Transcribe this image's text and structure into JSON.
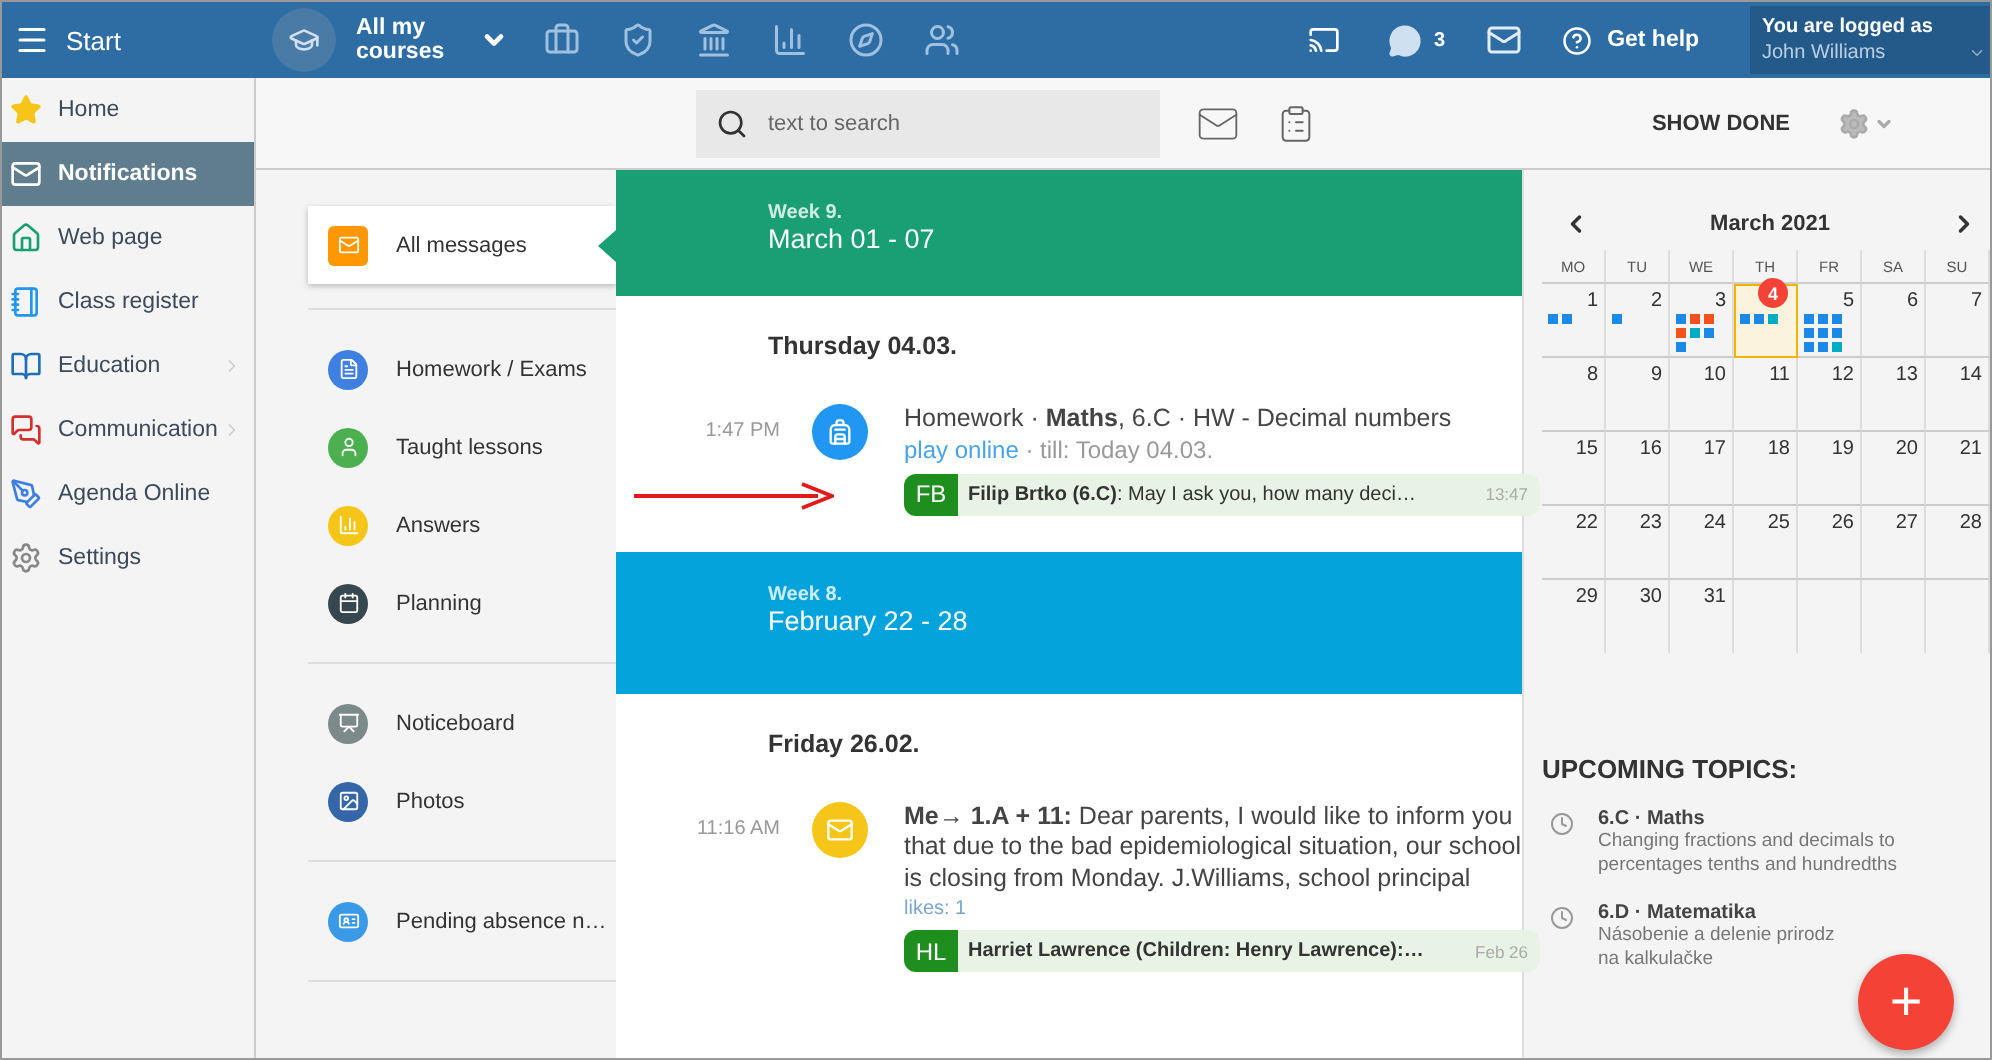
{
  "topbar": {
    "menu_label": "Start",
    "courses_label": "All my courses",
    "chat_count": "3",
    "help": "Get help",
    "user": {
      "caption": "You are logged as",
      "name": "John Williams"
    }
  },
  "sidebar": {
    "items": [
      {
        "label": "Home",
        "selected": false,
        "submenu": false
      },
      {
        "label": "Notifications",
        "selected": true,
        "submenu": false
      },
      {
        "label": "Web page",
        "selected": false,
        "submenu": false
      },
      {
        "label": "Class register",
        "selected": false,
        "submenu": false
      },
      {
        "label": "Education",
        "selected": false,
        "submenu": true
      },
      {
        "label": "Communication",
        "selected": false,
        "submenu": true
      },
      {
        "label": "Agenda Online",
        "selected": false,
        "submenu": false
      },
      {
        "label": "Settings",
        "selected": false,
        "submenu": false
      }
    ]
  },
  "toolbar": {
    "search": {
      "placeholder": "text to search"
    },
    "show_done": "SHOW DONE"
  },
  "filters": [
    [
      {
        "label": "All messages",
        "color": "#ff9800",
        "selected": true
      }
    ],
    [
      {
        "label": "Homework / Exams",
        "color": "#3f7fe0",
        "selected": false
      },
      {
        "label": "Taught lessons",
        "color": "#4caf50",
        "selected": false
      },
      {
        "label": "Answers",
        "color": "#f5c518",
        "selected": false
      },
      {
        "label": "Planning",
        "color": "#37474f",
        "selected": false
      }
    ],
    [
      {
        "label": "Noticeboard",
        "color": "#7d8a8a",
        "selected": false
      },
      {
        "label": "Photos",
        "color": "#3466a8",
        "selected": false
      }
    ],
    [
      {
        "label": "Pending absence n…",
        "color": "#3a9ae8",
        "selected": false
      }
    ]
  ],
  "feed": [
    {
      "week": "Week 9.",
      "range": "March 01 - 07",
      "color": "#1a9e73",
      "days": [
        {
          "day": "Thursday 04.03.",
          "messages": [
            {
              "kind": "homework",
              "time": "1:47 PM",
              "text": "Homework · **Maths**, 6.C · HW - Decimal numbers",
              "link": "play online",
              "meta": " · till: Today 04.03.",
              "comment": {
                "initials": "FB",
                "author": "Filip Brtko (6.C)",
                "text": ": May I ask you, how many deci…",
                "time": "13:47"
              }
            }
          ]
        }
      ]
    },
    {
      "week": "Week 8.",
      "range": "February 22 - 28",
      "color": "#05a3dc",
      "days": [
        {
          "day": "Friday 26.02.",
          "messages": [
            {
              "kind": "message",
              "time": "11:16 AM",
              "text": "**Me→ 1.A + 11:** Dear parents, I would like to inform you that due to the bad epidemiological situation, our school is closing from Monday. J.Williams, school principal",
              "likes": "likes: 1",
              "comment": {
                "initials": "HL",
                "author": "Harriet Lawrence (Children: Henry Lawrence):…",
                "time": "Feb 26"
              }
            }
          ]
        }
      ]
    }
  ],
  "calendar": {
    "title": "March 2021",
    "weekdays": [
      "MO",
      "TU",
      "WE",
      "TH",
      "FR",
      "SA",
      "SU"
    ],
    "weeks": [
      [
        {
          "date": "1",
          "today": false,
          "dots": [
            {
              "color": "#1e88e5"
            },
            {
              "color": "#1e88e5"
            }
          ]
        },
        {
          "date": "2",
          "today": false,
          "dots": [
            {
              "color": "#1e88e5"
            }
          ]
        },
        {
          "date": "3",
          "today": false,
          "dots": [
            {
              "color": "#1e88e5"
            },
            {
              "color": "#f4511e"
            },
            {
              "color": "#f4511e"
            },
            {
              "color": "#f4511e"
            },
            {
              "color": "#00acc1"
            },
            {
              "color": "#1e88e5"
            },
            {
              "color": "#1e88e5"
            }
          ]
        },
        {
          "badge": "4",
          "today": true,
          "dots": [
            {
              "color": "#1e88e5"
            },
            {
              "color": "#1e88e5"
            },
            {
              "color": "#00acc1"
            }
          ]
        },
        {
          "date": "5",
          "today": false,
          "dots": [
            {
              "color": "#1e88e5"
            },
            {
              "color": "#1e88e5"
            },
            {
              "color": "#1e88e5"
            },
            {
              "color": "#1e88e5"
            },
            {
              "color": "#1e88e5"
            },
            {
              "color": "#1e88e5"
            },
            {
              "color": "#1e88e5"
            },
            {
              "color": "#1e88e5"
            },
            {
              "color": "#00acc1"
            }
          ]
        },
        {
          "date": "6",
          "today": false
        },
        {
          "date": "7",
          "today": false
        }
      ],
      [
        {
          "date": "8",
          "today": false
        },
        {
          "date": "9",
          "today": false
        },
        {
          "date": "10",
          "today": false
        },
        {
          "date": "11",
          "today": false
        },
        {
          "date": "12",
          "today": false
        },
        {
          "date": "13",
          "today": false
        },
        {
          "date": "14",
          "today": false
        }
      ],
      [
        {
          "date": "15",
          "today": false
        },
        {
          "date": "16",
          "today": false
        },
        {
          "date": "17",
          "today": false
        },
        {
          "date": "18",
          "today": false
        },
        {
          "date": "19",
          "today": false
        },
        {
          "date": "20",
          "today": false
        },
        {
          "date": "21",
          "today": false
        }
      ],
      [
        {
          "date": "22",
          "today": false
        },
        {
          "date": "23",
          "today": false
        },
        {
          "date": "24",
          "today": false
        },
        {
          "date": "25",
          "today": false
        },
        {
          "date": "26",
          "today": false
        },
        {
          "date": "27",
          "today": false
        },
        {
          "date": "28",
          "today": false
        }
      ],
      [
        {
          "date": "29",
          "today": false
        },
        {
          "date": "30",
          "today": false
        },
        {
          "date": "31",
          "today": false
        }
      ]
    ]
  },
  "topics": {
    "title": "UPCOMING TOPICS:",
    "items": [
      {
        "title": "6.C · Maths",
        "description": "Changing fractions and decimals to percentages tenths and hundredths"
      },
      {
        "title": "6.D · Matematika",
        "description": "Násobenie a delenie prirodz",
        "description_2": "na kalkulačke"
      }
    ]
  },
  "fab": "+"
}
